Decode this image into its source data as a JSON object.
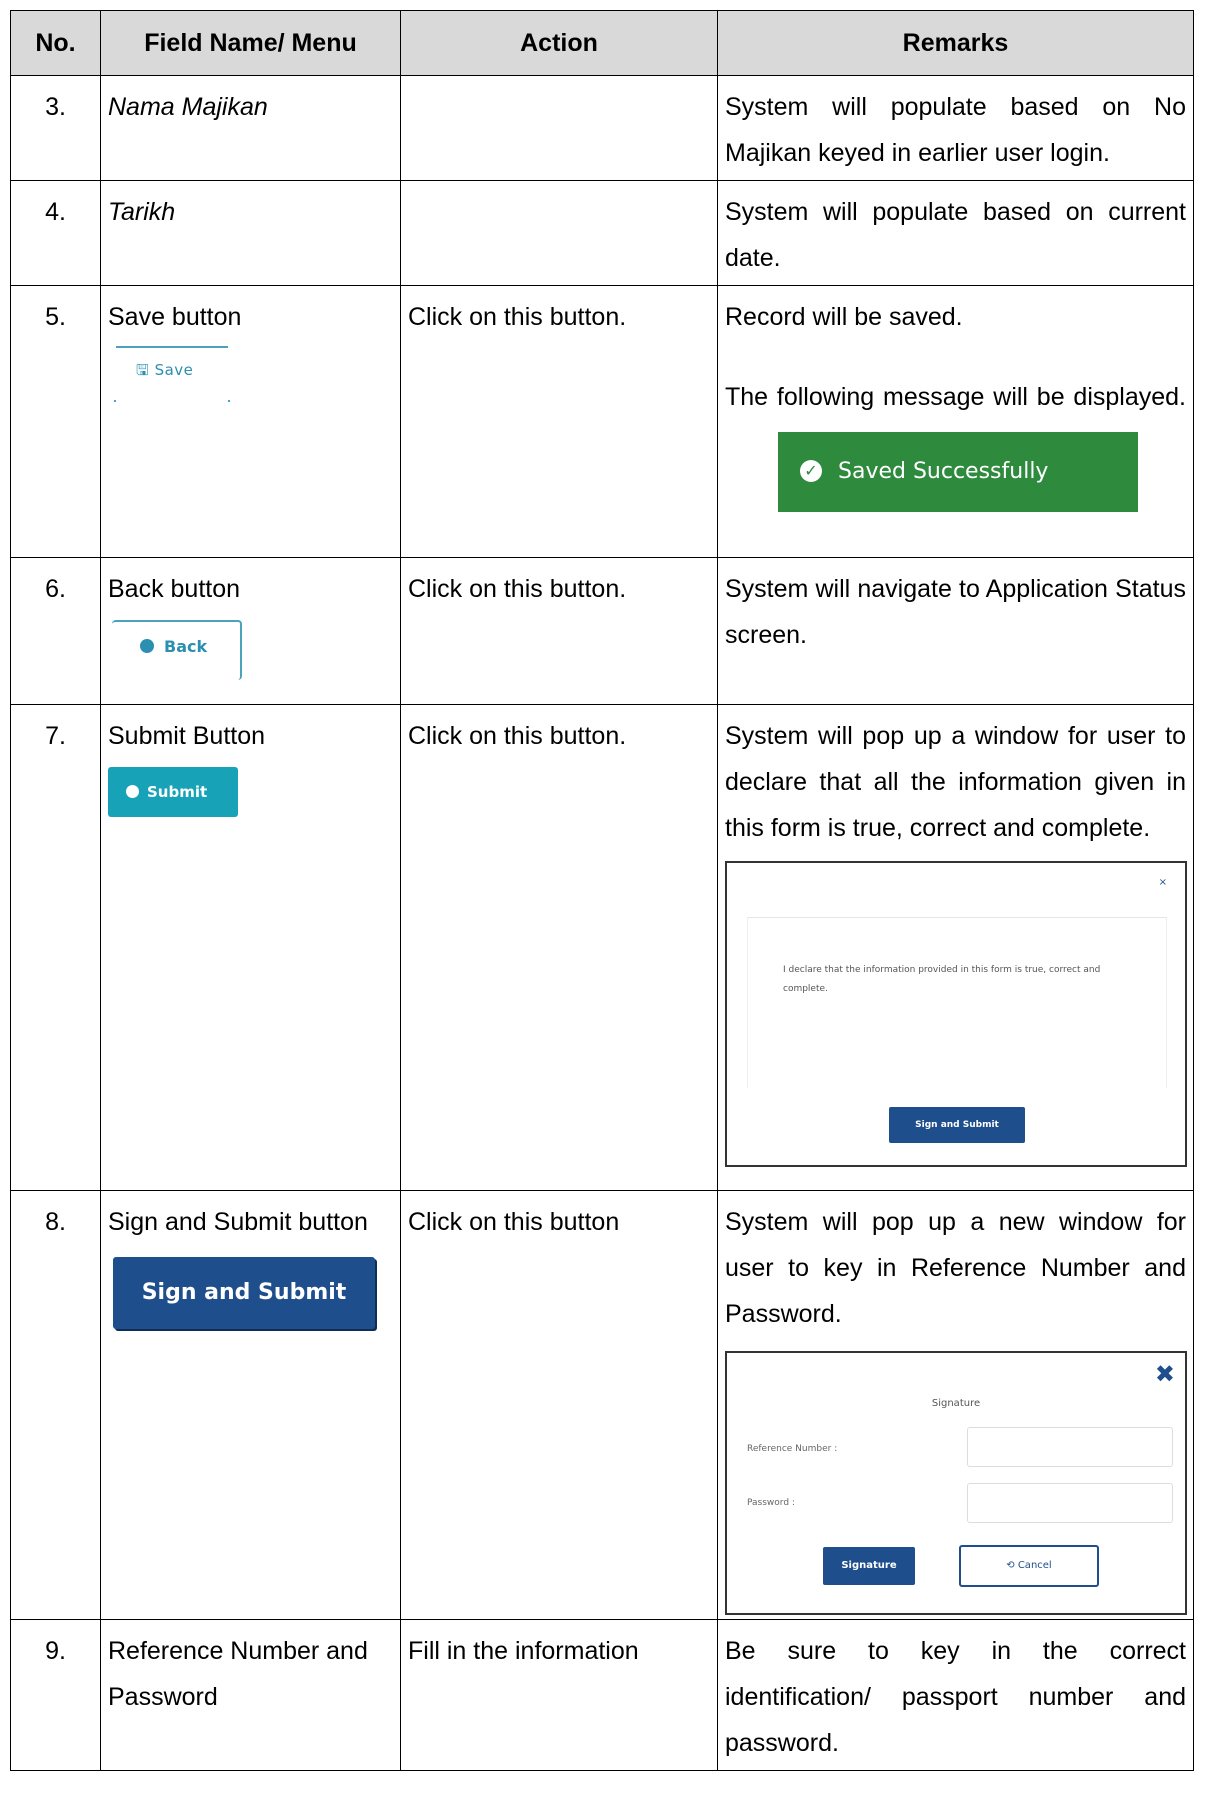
{
  "headers": [
    "No.",
    "Field Name/ Menu",
    "Action",
    "Remarks"
  ],
  "rows": [
    {
      "no": "3.",
      "field": "Nama Majikan",
      "action": "",
      "remarks": "System will populate based on No Majikan keyed in earlier user login."
    },
    {
      "no": "4.",
      "field": "Tarikh",
      "action": "",
      "remarks": "System will populate based on current date."
    },
    {
      "no": "5.",
      "field": "Save button",
      "button_label": "Save",
      "action": "Click on this button.",
      "remarks": "Record will be saved.",
      "remarks_2": "The following message will be displayed.",
      "banner_text": "Saved Successfully"
    },
    {
      "no": "6.",
      "field": "Back button",
      "button_label": "Back",
      "action": "Click on this button.",
      "remarks": "System will navigate to Application Status screen."
    },
    {
      "no": "7.",
      "field": "Submit Button",
      "button_label": "Submit",
      "action": "Click on this button.",
      "remarks": "System will pop up a window for user to declare that all the information given in this form is true, correct and complete.",
      "popup": {
        "close": "×",
        "declaration": "I declare that the information provided in this form is true, correct and complete.",
        "name": "",
        "button": "Sign and Submit"
      }
    },
    {
      "no": "8.",
      "field": "Sign and Submit button",
      "button_label": "Sign and Submit",
      "action": "Click on this button",
      "remarks": "System will pop up a new window for user to key in Reference Number and Password.",
      "popup": {
        "close": "✖",
        "title": "Signature",
        "ref_label": "Reference Number :",
        "pwd_label": "Password :",
        "sign_button": "Signature",
        "cancel_button": "Cancel"
      }
    },
    {
      "no": "9.",
      "field": "Reference Number and Password",
      "action": "Fill in the information",
      "remarks": "Be sure to key in the correct identification/ passport number and password."
    }
  ],
  "colors": {
    "header_bg": "#d9d9d9",
    "success_green": "#2e8b3e",
    "submit_teal": "#17a2b8",
    "primary_blue": "#1f4e8c"
  }
}
